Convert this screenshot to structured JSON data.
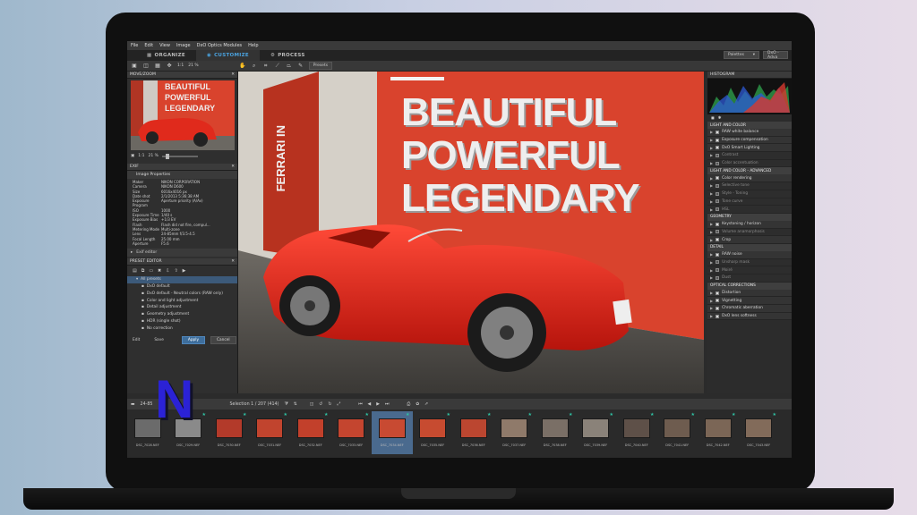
{
  "menu": [
    "File",
    "Edit",
    "View",
    "Image",
    "DxO Optics Modules",
    "Help"
  ],
  "tabs": [
    {
      "label": "ORGANIZE",
      "icon": "grid-icon"
    },
    {
      "label": "CUSTOMIZE",
      "icon": "eye-icon"
    },
    {
      "label": "PROCESS",
      "icon": "gear-icon"
    }
  ],
  "top_right": {
    "palettes": "Palettes",
    "workspace": "DxO - Adva"
  },
  "toolbar": {
    "zoom_ratio": "1:1",
    "zoom_percent": "21 %",
    "presets": "Presets"
  },
  "move_zoom": {
    "title": "MOVE/ZOOM",
    "ratio": "1:1",
    "percent": "21 %"
  },
  "exif": {
    "title": "EXIF",
    "subtitle": "Image Properties",
    "rows": [
      {
        "k": "Maker",
        "v": "NIKON CORPORATION"
      },
      {
        "k": "Camera",
        "v": "NIKON D600"
      },
      {
        "k": "Size",
        "v": "6016x4016 px"
      },
      {
        "k": "Date shot",
        "v": "2/1/2013 5:36:38 AM"
      },
      {
        "k": "Exposure Program",
        "v": "Aperture priority (A/Av)"
      },
      {
        "k": "ISO",
        "v": "1000"
      },
      {
        "k": "Exposure Time",
        "v": "1/40 s"
      },
      {
        "k": "Exposure Bias",
        "v": "+1/3 EV"
      },
      {
        "k": "Flash",
        "v": "Flash did not fire, compul..."
      },
      {
        "k": "Metering Mode",
        "v": "Multi-zone"
      },
      {
        "k": "Lens",
        "v": "24-85mm f/3.5-4.5"
      },
      {
        "k": "Focal Length",
        "v": "25.00 mm"
      },
      {
        "k": "Aperture",
        "v": "F5.6"
      }
    ]
  },
  "exif_editor": "Exif editor",
  "preset_editor": {
    "title": "PRESET EDITOR",
    "items": [
      {
        "label": "All presets",
        "level": 0,
        "selected": true
      },
      {
        "label": "DxO default",
        "level": 1
      },
      {
        "label": "DxO default - Neutral colors (RAW only)",
        "level": 1
      },
      {
        "label": "Color and light adjustment",
        "level": 1
      },
      {
        "label": "Detail adjustment",
        "level": 1
      },
      {
        "label": "Geometry adjustment",
        "level": 1
      },
      {
        "label": "HDR (single shot)",
        "level": 1
      },
      {
        "label": "No correction",
        "level": 1
      }
    ],
    "edit": "Edit",
    "save": "Save",
    "apply": "Apply",
    "cancel": "Cancel"
  },
  "wall_text": [
    "BEAUTIFUL",
    "POWERFUL",
    "LEGENDARY"
  ],
  "side_wall_text": "FERRARI IN",
  "right_panel": {
    "histogram": "HISTOGRAM",
    "sections": [
      {
        "title": "LIGHT AND COLOR",
        "items": [
          {
            "label": "RAW white balance",
            "on": true
          },
          {
            "label": "Exposure compensation",
            "on": true
          },
          {
            "label": "DxO Smart Lighting",
            "on": true
          },
          {
            "label": "Contrast",
            "on": false
          },
          {
            "label": "Color accentuation",
            "on": false
          }
        ]
      },
      {
        "title": "LIGHT AND COLOR - ADVANCED",
        "items": [
          {
            "label": "Color rendering",
            "on": true
          },
          {
            "label": "Selective tone",
            "on": false
          },
          {
            "label": "Style - Toning",
            "on": false
          },
          {
            "label": "Tone curve",
            "on": false
          },
          {
            "label": "HSL",
            "on": false
          }
        ]
      },
      {
        "title": "GEOMETRY",
        "items": [
          {
            "label": "Keystoning / horizon",
            "on": true
          },
          {
            "label": "Volume anamorphosis",
            "on": false
          },
          {
            "label": "Crop",
            "on": true
          }
        ]
      },
      {
        "title": "DETAIL",
        "items": [
          {
            "label": "RAW noise",
            "on": true
          },
          {
            "label": "Unsharp mask",
            "on": false
          },
          {
            "label": "Moiré",
            "on": false
          },
          {
            "label": "Dust",
            "on": false
          }
        ]
      },
      {
        "title": "OPTICAL CORRECTIONS",
        "items": [
          {
            "label": "Distortion",
            "on": true
          },
          {
            "label": "Vignetting",
            "on": true
          },
          {
            "label": "Chromatic aberration",
            "on": true
          },
          {
            "label": "DxO lens softness",
            "on": true
          }
        ]
      }
    ]
  },
  "film_toolbar": {
    "folder": "24-85",
    "selection": "Selection 1 / 207 (414)"
  },
  "filmstrip": [
    {
      "name": "DSC_7028.NEF",
      "color": "#6b6b6b"
    },
    {
      "name": "DSC_7029.NEF",
      "color": "#8a8a8a"
    },
    {
      "name": "DSC_7030.NEF",
      "color": "#b33a2a"
    },
    {
      "name": "DSC_7031.NEF",
      "color": "#c1442e"
    },
    {
      "name": "DSC_7032.NEF",
      "color": "#c2402b"
    },
    {
      "name": "DSC_7033.NEF",
      "color": "#c4452f"
    },
    {
      "name": "DSC_7034.NEF",
      "color": "#c84a32",
      "selected": true
    },
    {
      "name": "DSC_7035.NEF",
      "color": "#c74b30"
    },
    {
      "name": "DSC_7036.NEF",
      "color": "#bb4630"
    },
    {
      "name": "DSC_7037.NEF",
      "color": "#8f7a6a"
    },
    {
      "name": "DSC_7038.NEF",
      "color": "#7a6f66"
    },
    {
      "name": "DSC_7039.NEF",
      "color": "#8a8279"
    },
    {
      "name": "DSC_7040.NEF",
      "color": "#5e5048"
    },
    {
      "name": "DSC_7041.NEF",
      "color": "#6e5c4f"
    },
    {
      "name": "DSC_7042.NEF",
      "color": "#7b6656"
    },
    {
      "name": "DSC_7043.NEF",
      "color": "#826b5a"
    }
  ],
  "logo_letter": "N",
  "colors": {
    "accent": "#4aa3e0",
    "wall_red": "#d9432d",
    "car_red": "#e02a1c",
    "logo_blue": "#2b22d6"
  }
}
